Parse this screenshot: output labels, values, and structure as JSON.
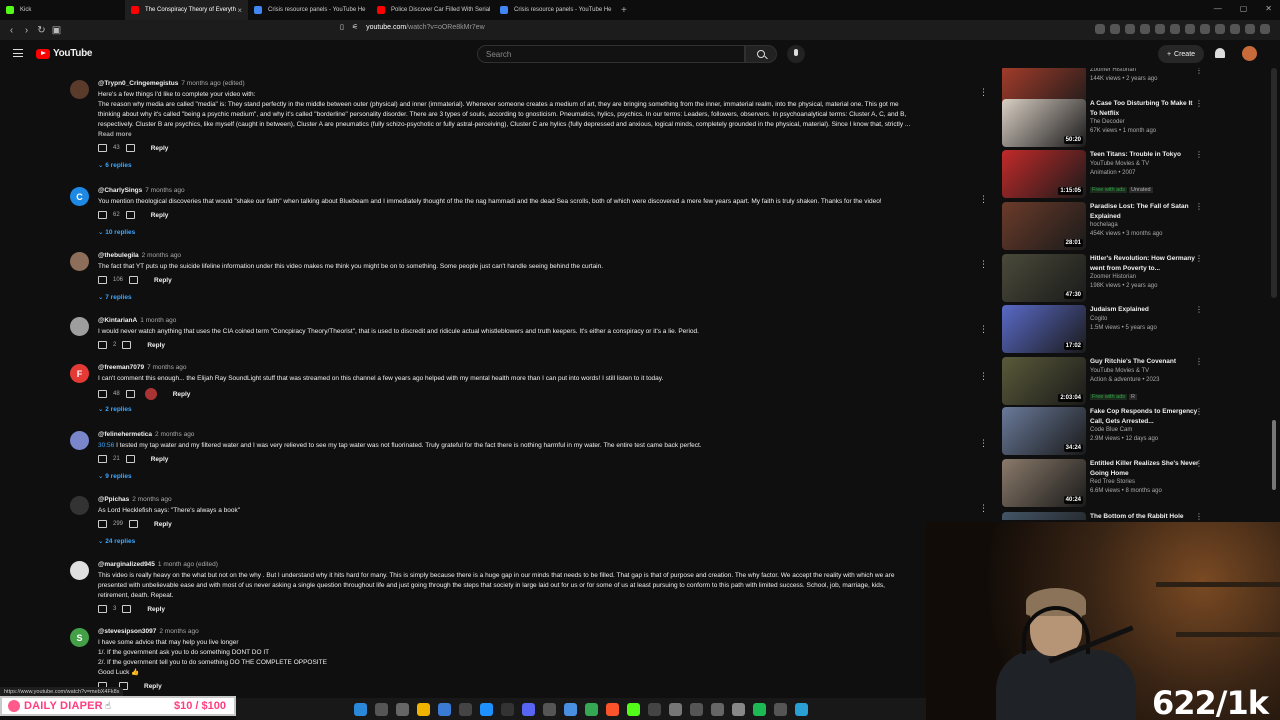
{
  "browser": {
    "tabs": [
      {
        "label": "Kick",
        "color": "#53fc18"
      },
      {
        "label": "The Conspiracy Theory of Everyth",
        "color": "#ff0000",
        "active": true
      },
      {
        "label": "Crisis resource panels - YouTube He",
        "color": "#4285f4"
      },
      {
        "label": "Police Discover Car Filled With Serial",
        "color": "#ff0000"
      },
      {
        "label": "Crisis resource panels - YouTube He",
        "color": "#4285f4"
      }
    ],
    "new_tab": "+",
    "url_host": "youtube.com",
    "url_path": "/watch?v=oORe8kMr7ew"
  },
  "youtube": {
    "logo_word": "YouTube",
    "search_placeholder": "Search",
    "create_label": "Create"
  },
  "comments": [
    {
      "handle": "@Trypn0_Cringemegistus",
      "time": "7 months ago (edited)",
      "avatar_color": "#5a3a2a",
      "avatar_letter": "",
      "lines": [
        "Here's a few things I'd like to complete your video with:",
        "The reason why media are called \"media\" is: They stand perfectly in the middle between outer (physical) and inner (immaterial). Whenever someone creates a medium of art, they are bringing something from the inner, immaterial realm, into the physical, material one. This got me",
        "thinking about why it's called \"being a psychic medium\", and why it's called \"borderline\" personality disorder. There are 3 types of souls, according to gnosticism. Pneumatics, hylics, psychics. In our terms: Leaders, followers, observers. In psychoanalytical terms: Cluster A, C, and B,",
        "respectively. Cluster B are psychics, like myself (caught in between), Cluster A are pneumatics (fully schizo-psychotic or fully astral-perceiving), Cluster C are hylics (fully depressed and anxious, logical minds, completely grounded in the physical, material). Since I know that, strictly ..."
      ],
      "read_more": "Read more",
      "likes": "43",
      "reply": "Reply",
      "replies": "6 replies"
    },
    {
      "handle": "@CharlySings",
      "time": "7 months ago",
      "avatar_color": "#1e88e5",
      "avatar_letter": "C",
      "lines": [
        "You mention theological discoveries that would \"shake our faith\" when talking about Bluebeam and I immediately thought of the the nag hammadi and the dead Sea scrolls,  both of which were discovered a mere few years apart.  My faith is truly shaken. Thanks for the video!"
      ],
      "likes": "62",
      "reply": "Reply",
      "replies": "10 replies"
    },
    {
      "handle": "@thebulegila",
      "time": "2 months ago",
      "avatar_color": "#8d6e5a",
      "avatar_letter": "",
      "lines": [
        "The fact that YT puts up the suicide lifeline information under this video makes me think you might be on to something. Some people just can't handle seeing behind the curtain."
      ],
      "likes": "106",
      "reply": "Reply",
      "replies": "7 replies"
    },
    {
      "handle": "@KintarianA",
      "time": "1 month ago",
      "avatar_color": "#9e9e9e",
      "avatar_letter": "",
      "lines": [
        "I would never watch anything that uses the CIA coined term \"Concpiracy Theory/Theorist\", that is used to discredit and ridicule actual whistleblowers and truth keepers. It's either a conspiracy or it's a lie. Period."
      ],
      "likes": "2",
      "reply": "Reply",
      "replies": ""
    },
    {
      "handle": "@freeman7079",
      "time": "7 months ago",
      "avatar_color": "#e53935",
      "avatar_letter": "F",
      "lines": [
        "I can't comment this enough... the Elijah Ray SoundLight stuff that was streamed on this channel a few years ago helped with my mental health more than I can put into words! I still listen to it today."
      ],
      "likes": "48",
      "reply": "Reply",
      "replies": "2 replies"
    },
    {
      "handle": "@felinehermetica",
      "time": "2 months ago",
      "avatar_color": "#7986cb",
      "avatar_letter": "",
      "timestamp_link": "30:56",
      "lines": [
        " I tested my tap water and my filtered water and I was very relieved to see my tap water was not fluorinated. Truly grateful for the fact there is nothing harmful in my water. The entire test came back perfect."
      ],
      "likes": "21",
      "reply": "Reply",
      "replies": "9 replies"
    },
    {
      "handle": "@Ppichas",
      "time": "2 months ago",
      "avatar_color": "#333333",
      "avatar_letter": "",
      "lines": [
        "As Lord Hecklefish says: \"There's always a book\""
      ],
      "likes": "299",
      "reply": "Reply",
      "replies": "24 replies"
    },
    {
      "handle": "@marginalized945",
      "time": "1 month ago (edited)",
      "avatar_color": "#e0e0e0",
      "avatar_letter": "",
      "lines": [
        "This video is really heavy on the what but not on the why .  But I understand why it hits hard for many. This is simply because there is a huge gap in our minds that needs to be filled. That gap is that of purpose and creation. The why factor. We accept the reality with which we are",
        "presented with unbelievable ease and with most of us never asking a single question throughout life and just going through the steps that society in large laid out for us or for some of us at  least pursuing to conform to this path with limited success. School, job, marriage, kids,",
        "retirement, death. Repeat."
      ],
      "likes": "3",
      "reply": "Reply",
      "replies": ""
    },
    {
      "handle": "@stevesipson3097",
      "time": "2 months ago",
      "avatar_color": "#43a047",
      "avatar_letter": "S",
      "lines": [
        "I have some advice that may help you live longer",
        "1/. If the government ask you to do something DONT DO IT",
        "2/. If the government tell you to do something DO THE COMPLETE OPPOSITE",
        "Good Luck 👍"
      ],
      "likes": "",
      "reply": "Reply",
      "replies": ""
    }
  ],
  "recommendations": [
    {
      "title": "",
      "channel": "Zoomer Historian",
      "stats": "144K views • 2 years ago",
      "duration": "32:33",
      "thumb": "#a33c2a"
    },
    {
      "title": "A Case Too Disturbing To Make It To Netflix",
      "channel": "The Decoder",
      "stats": "67K views • 1 month ago",
      "duration": "50:20",
      "thumb": "#d9cfc4"
    },
    {
      "title": "Teen Titans: Trouble in Tokyo",
      "channel": "YouTube Movies & TV",
      "stats": "Animation • 2007",
      "duration": "1:15:05",
      "thumb": "#c22a2a",
      "badge": "Free with ads",
      "badge2": "Unrated"
    },
    {
      "title": "Paradise Lost: The Fall of Satan Explained",
      "channel": "hochelaga",
      "stats": "454K views • 3 months ago",
      "duration": "28:01",
      "thumb": "#6b3b2a"
    },
    {
      "title": "Hitler's Revolution: How Germany went from Poverty to...",
      "channel": "Zoomer Historian",
      "stats": "198K views • 2 years ago",
      "duration": "47:30",
      "thumb": "#4a4a3a"
    },
    {
      "title": "Judaism Explained",
      "channel": "Cogito",
      "stats": "1.5M views • 5 years ago",
      "duration": "17:02",
      "thumb": "#5a6ac8"
    },
    {
      "title": "Guy Ritchie's The Covenant",
      "channel": "YouTube Movies & TV",
      "stats": "Action & adventure • 2023",
      "duration": "2:03:04",
      "thumb": "#5a5a3a",
      "badge": "Free with ads",
      "badge2": "R"
    },
    {
      "title": "Fake Cop Responds to Emergency Call, Gets Arrested...",
      "channel": "Code Blue Cam",
      "stats": "2.9M views • 12 days ago",
      "duration": "34:24",
      "thumb": "#6a7a9a"
    },
    {
      "title": "Entitled Killer Realizes She's Never Going Home",
      "channel": "Red Tree Stories",
      "stats": "6.6M views • 8 months ago",
      "duration": "40:24",
      "thumb": "#8a7a6a"
    },
    {
      "title": "The Bottom of the Rabbit Hole",
      "channel": "",
      "stats": "",
      "duration": "",
      "thumb": "#445566"
    }
  ],
  "overlay": {
    "sub_count": "622/1k",
    "banner_text": "DAILY DIAPER",
    "banner_goal": "$10 / $100",
    "status_url": "https://www.youtube.com/watch?v=mebX4Fk8s"
  }
}
